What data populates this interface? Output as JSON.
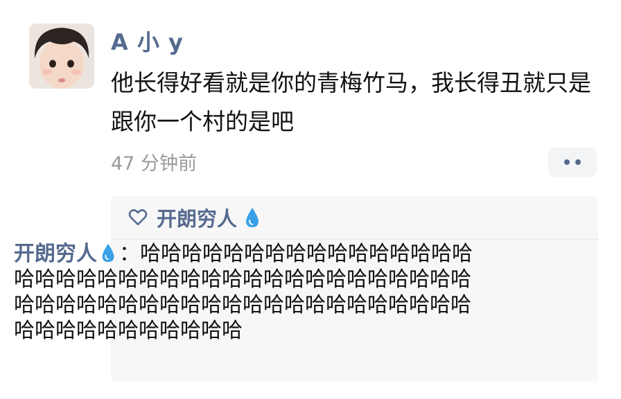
{
  "post": {
    "username": "A 小 y",
    "text": "他长得好看就是你的青梅竹马，我长得丑就只是跟你一个村的是吧",
    "timestamp": "47 分钟前"
  },
  "likes": {
    "name": "开朗穷人"
  },
  "comment": {
    "author": "开朗穷人",
    "separator": "：",
    "text": "哈哈哈哈哈哈哈哈哈哈哈哈哈哈哈哈哈哈哈哈哈哈哈哈哈哈哈哈哈哈哈哈哈哈哈哈哈哈哈哈哈哈哈哈哈哈哈哈哈哈哈哈哈哈哈哈哈哈哈哈哈哈哈哈哈哈哈哈哈哈哈"
  },
  "colors": {
    "link": "#566a8f",
    "drop": "#3aa0e8"
  }
}
